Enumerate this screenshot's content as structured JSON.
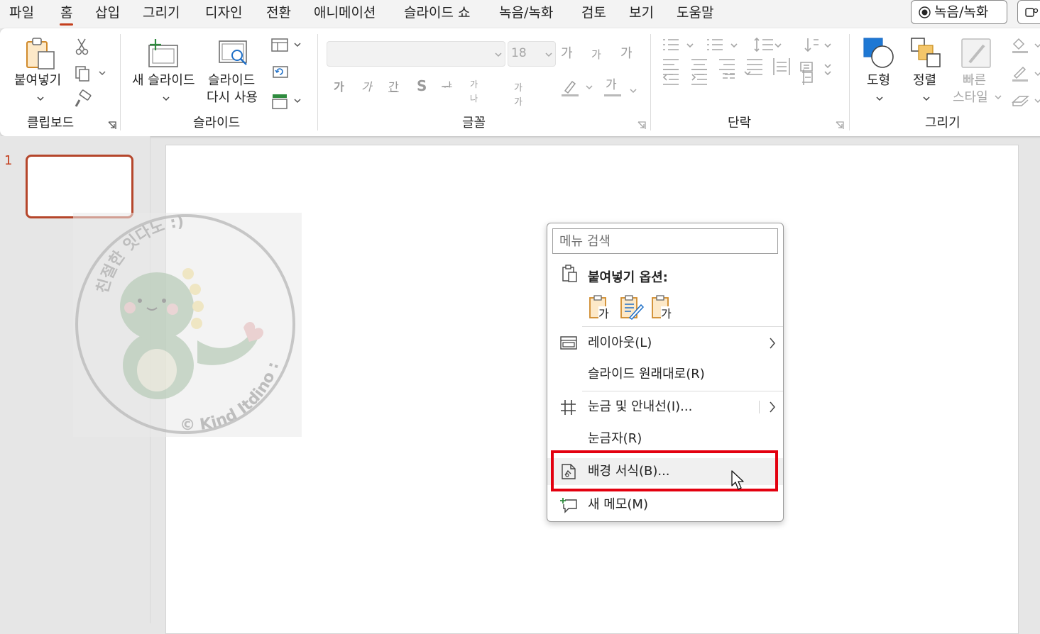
{
  "menu_tabs": {
    "file": "파일",
    "home": "홈",
    "insert": "삽입",
    "draw": "그리기",
    "design": "디자인",
    "transitions": "전환",
    "animations": "애니메이션",
    "slideshow": "슬라이드 쇼",
    "record": "녹음/녹화",
    "review": "검토",
    "view": "보기",
    "help": "도움말"
  },
  "record_button": "녹음/녹화",
  "ribbon": {
    "clipboard": {
      "group": "클립보드",
      "paste": "붙여넣기"
    },
    "slides": {
      "group": "슬라이드",
      "new_slide": "새 슬라이드",
      "reuse_line1": "슬라이드",
      "reuse_line2": "다시 사용"
    },
    "font": {
      "group": "글꼴",
      "font_name": "",
      "font_size": "18",
      "grow": "가",
      "shrink": "가",
      "clear": "가",
      "bold": "가",
      "italic": "가",
      "underline": "간",
      "shadow": "S",
      "strike": "ᆉ",
      "spacing": "가나",
      "case": "가가",
      "color_char": "가"
    },
    "paragraph": {
      "group": "단락"
    },
    "drawing": {
      "group": "그리기",
      "shapes": "도형",
      "arrange": "정렬",
      "quick_line1": "빠른",
      "quick_line2": "스타일"
    }
  },
  "thumbnails": {
    "slide_number": "1"
  },
  "context_menu": {
    "search_placeholder": "메뉴 검색",
    "paste_options": "붙여넣기 옵션:",
    "paste_glyph": "가",
    "layout": "레이아웃(L)",
    "reset_slide": "슬라이드 원래대로(R)",
    "grid": "눈금 및 안내선(I)...",
    "ruler": "눈금자(R)",
    "format_background": "배경 서식(B)...",
    "new_comment": "새 메모(M)"
  },
  "watermark": {
    "text_top": "친절한 잇다노 :)",
    "text_bottom": "© Kind Itdino :)"
  },
  "colors": {
    "accent": "#c43e1c",
    "highlight": "#e3000f",
    "thumb_border": "#b5462b"
  }
}
